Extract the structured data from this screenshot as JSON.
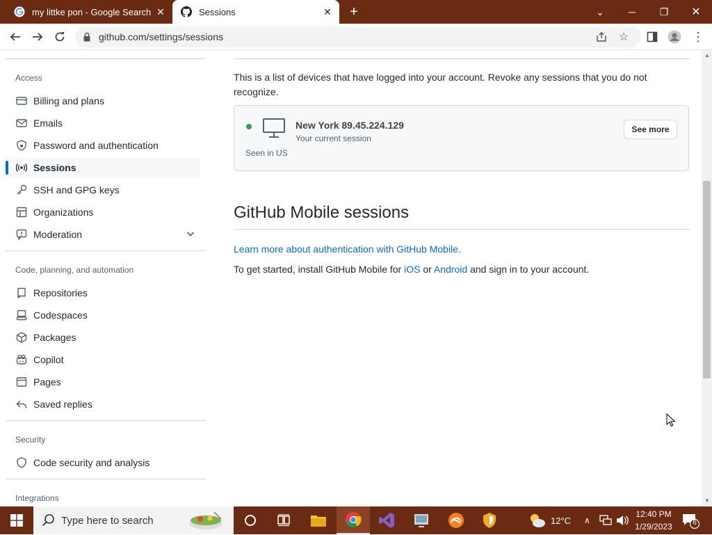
{
  "browser": {
    "tabs": [
      {
        "title": "my littke pon - Google Search",
        "icon": "google-icon"
      },
      {
        "title": "Sessions",
        "icon": "github-icon"
      }
    ],
    "new_tab_label": "+",
    "url": "github.com/settings/sessions"
  },
  "sidebar": {
    "sections": [
      {
        "heading": "Access"
      },
      {
        "heading": "Code, planning, and automation"
      },
      {
        "heading": "Security"
      },
      {
        "heading": "Integrations"
      }
    ],
    "items": [
      {
        "label": "Billing and plans",
        "icon": "credit-card-icon"
      },
      {
        "label": "Emails",
        "icon": "mail-icon"
      },
      {
        "label": "Password and authentication",
        "icon": "shield-lock-icon"
      },
      {
        "label": "Sessions",
        "icon": "broadcast-icon"
      },
      {
        "label": "SSH and GPG keys",
        "icon": "key-icon"
      },
      {
        "label": "Organizations",
        "icon": "table-icon"
      },
      {
        "label": "Moderation",
        "icon": "report-icon"
      },
      {
        "label": "Repositories",
        "icon": "repo-icon"
      },
      {
        "label": "Codespaces",
        "icon": "codespaces-icon"
      },
      {
        "label": "Packages",
        "icon": "package-icon"
      },
      {
        "label": "Copilot",
        "icon": "copilot-icon"
      },
      {
        "label": "Pages",
        "icon": "browser-icon"
      },
      {
        "label": "Saved replies",
        "icon": "reply-icon"
      },
      {
        "label": "Code security and analysis",
        "icon": "shield-icon"
      }
    ],
    "active_item": "Sessions"
  },
  "main": {
    "intro": "This is a list of devices that have logged into your account. Revoke any sessions that you do not recognize.",
    "session": {
      "location": "New York 89.45.224.129",
      "current": "Your current session",
      "seen": "Seen in US",
      "see_more": "See more",
      "status_color": "#2da44e"
    },
    "mobile": {
      "heading": "GitHub Mobile sessions",
      "learn_more": "Learn more about authentication with GitHub Mobile.",
      "started_prefix": "To get started, install GitHub Mobile for",
      "ios": "iOS",
      "or": "or",
      "android": "Android",
      "started_suffix": "and sign in to your account."
    }
  },
  "taskbar": {
    "search_placeholder": "Type here to search",
    "weather": "12°C",
    "time": "12:40 PM",
    "date": "1/29/2023",
    "notifications": "6"
  },
  "colors": {
    "accent": "#0969da",
    "chrome_frame": "#6b2a12",
    "success": "#2da44e"
  }
}
